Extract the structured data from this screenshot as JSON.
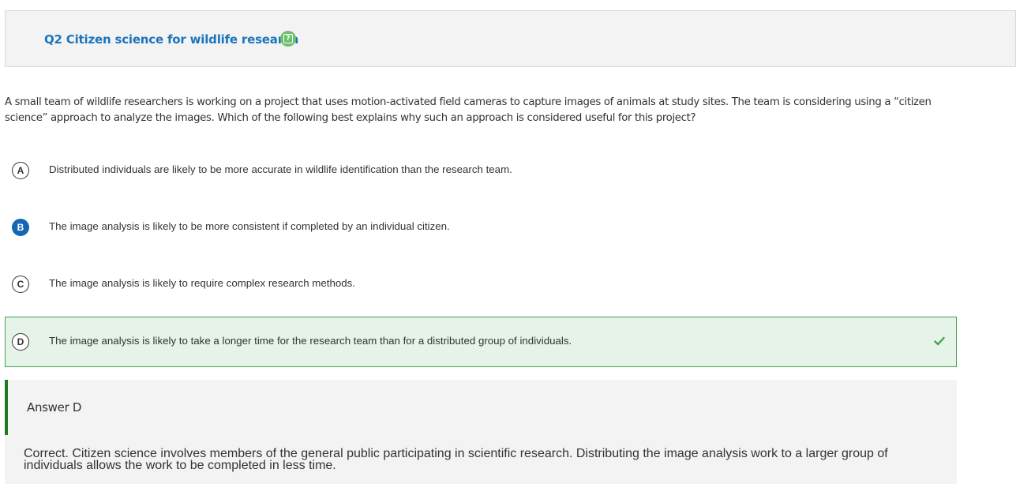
{
  "question": {
    "title": "Q2 Citizen science for wildlife research",
    "help_icon": "help-question-icon",
    "stem": "A small team of wildlife researchers is working on a project that uses motion-activated field cameras to capture images of animals at study sites. The team is considering using a “citizen science” approach to analyze the images. Which of the following best explains why such an approach is considered useful for this project?"
  },
  "options": [
    {
      "letter": "A",
      "text": "Distributed individuals are likely to be more accurate in wildlife identification than the research team."
    },
    {
      "letter": "B",
      "text": "The image analysis is likely to be more consistent if completed by an individual citizen."
    },
    {
      "letter": "C",
      "text": "The image analysis is likely to require complex research methods."
    },
    {
      "letter": "D",
      "text": "The image analysis is likely to take a longer time for the research team than for a distributed group of individuals."
    }
  ],
  "selected_option": "B",
  "correct_option": "D",
  "answer": {
    "label": "Answer D",
    "explanation": "Correct. Citizen science involves members of the general public participating in scientific research. Distributing the image analysis work to a larger group of individuals allows the work to be completed in less time."
  },
  "colors": {
    "title_blue": "#1b75bc",
    "selected_blue": "#1467b3",
    "correct_green": "#44a04a",
    "correct_bg": "#e6f3e9",
    "answer_bar_green": "#1f7a24",
    "help_green": "#6cc06b"
  }
}
